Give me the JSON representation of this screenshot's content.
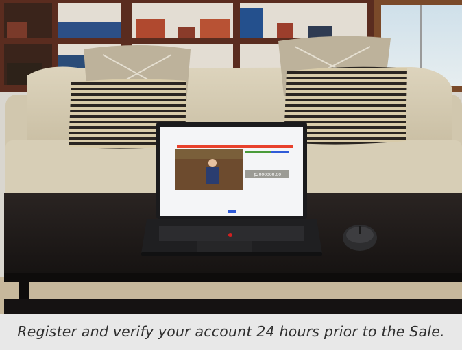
{
  "caption": "Register and verify your account 24 hours prior to the Sale.",
  "laptop_screen": {
    "bid_amount": "$2000000.00",
    "accent_color": "#e8412c",
    "button_green_color": "#4a9b3a",
    "button_blue_color": "#2f5bd8"
  },
  "colors": {
    "caption_bg": "#e8e8e8",
    "caption_text": "#2f2f2f",
    "wall": "#d9d6cf",
    "bookshelf": "#5a2c1f",
    "sofa": "#d6cdb6",
    "table": "#1f1a18"
  },
  "objects": [
    "bookshelf",
    "window",
    "sofa",
    "striped-pillow",
    "patterned-pillow",
    "coffee-table",
    "laptop",
    "wireless-mouse",
    "carpet"
  ]
}
